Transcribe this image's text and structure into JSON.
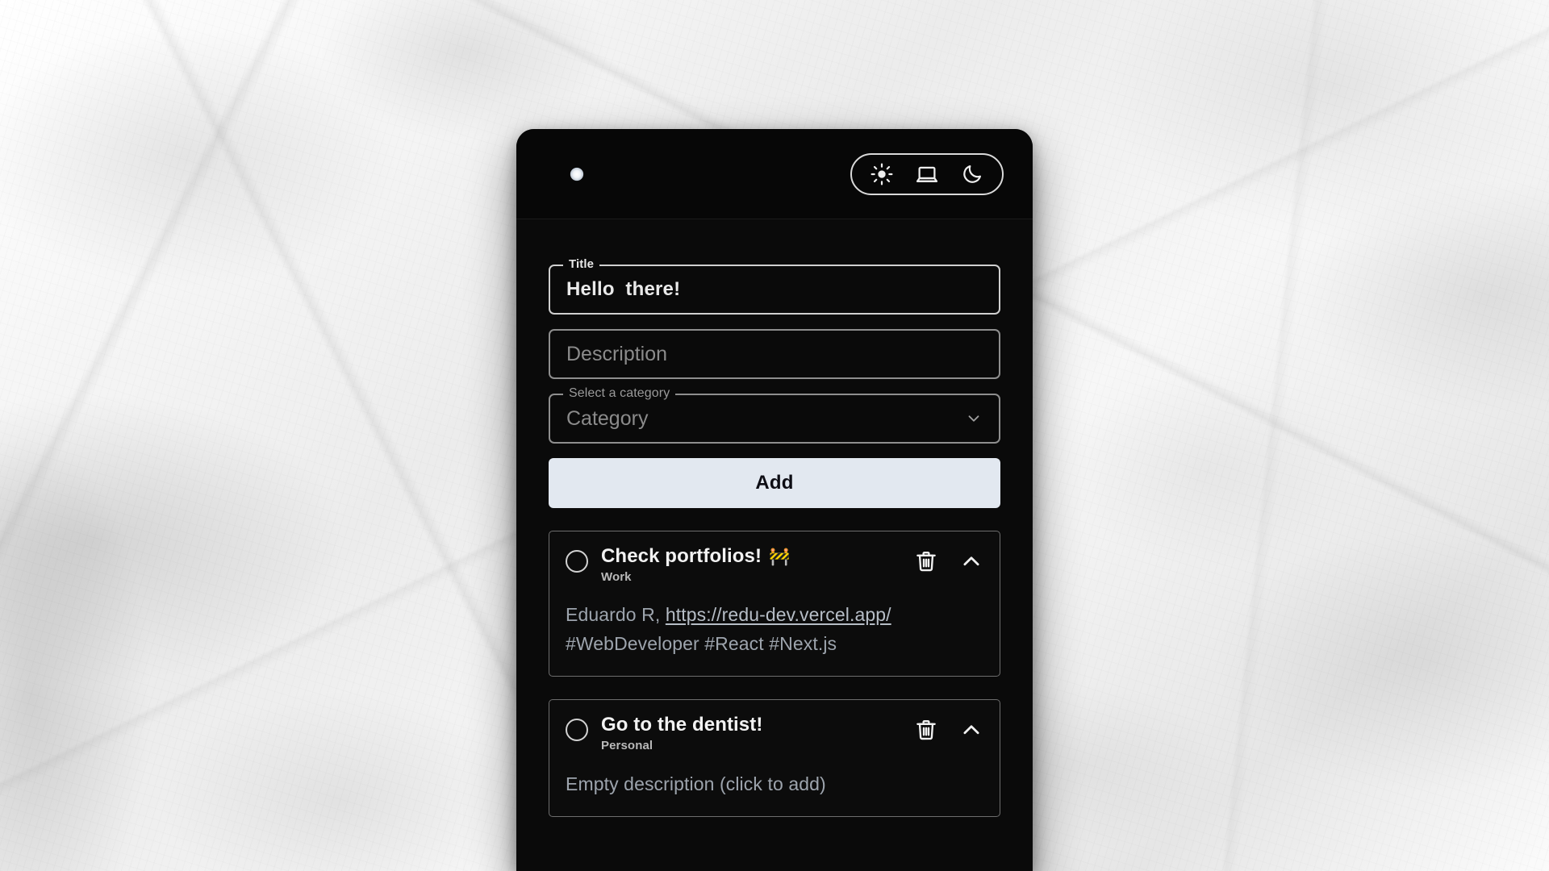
{
  "background": {
    "texture": "crumpled-white-paper"
  },
  "app": {
    "panel_bg": "#0a0a0a",
    "logo_name": "starburst-logo",
    "header": {
      "theme_toggle": {
        "options": [
          {
            "name": "light",
            "icon": "sun-icon"
          },
          {
            "name": "system",
            "icon": "laptop-icon"
          },
          {
            "name": "dark",
            "icon": "moon-icon"
          }
        ]
      }
    },
    "form": {
      "title_field": {
        "legend": "Title",
        "value": "Hello  there!"
      },
      "description_field": {
        "placeholder": "Description",
        "value": ""
      },
      "category_field": {
        "legend": "Select a category",
        "placeholder": "Category",
        "value": "",
        "chevron": "chevron-down-icon"
      },
      "add_button": {
        "label": "Add",
        "bg": "#e2e8f0",
        "fg": "#0d0d14"
      }
    },
    "tasks": [
      {
        "title": "Check portfolios!",
        "emoji": "🚧",
        "category": "Work",
        "checked": false,
        "description_prefix": "Eduardo R, ",
        "description_link": "https://redu-dev.vercel.app/",
        "tags": "#WebDeveloper #React #Next.js",
        "delete_icon": "trash-icon",
        "collapse_icon": "chevron-up-icon"
      },
      {
        "title": "Go to the dentist!",
        "emoji": "",
        "category": "Personal",
        "checked": false,
        "description_empty": "Empty description (click to add)",
        "delete_icon": "trash-icon",
        "collapse_icon": "chevron-up-icon"
      }
    ]
  }
}
